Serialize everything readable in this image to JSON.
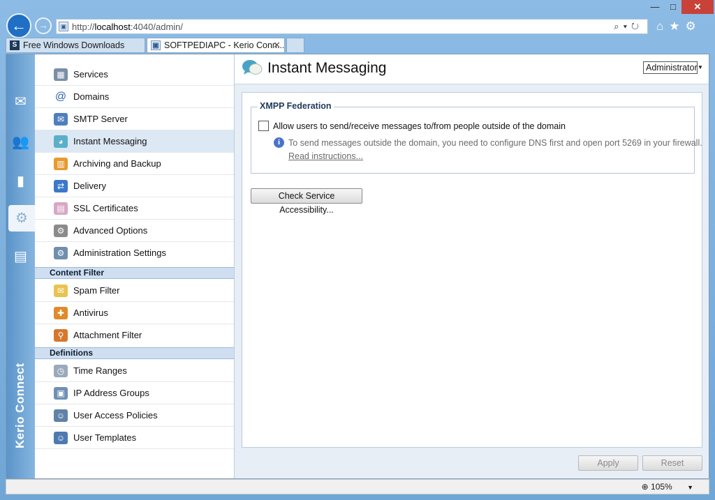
{
  "browser": {
    "url_prefix": "http://",
    "url_host": "localhost",
    "url_rest": ":4040/admin/",
    "tabs": [
      {
        "label": "Free Windows Downloads",
        "icon": "S"
      },
      {
        "label": "SOFTPEDIAPC - Kerio Conn...",
        "close": "✕"
      }
    ],
    "window_controls": {
      "minimize": "—",
      "maximize": "□",
      "close": "✕"
    },
    "zoom": "105%"
  },
  "rail": {
    "brand": "Kerio Connect",
    "icons": [
      "mail-icon",
      "users-icon",
      "statistics-icon",
      "settings-icon",
      "logs-icon"
    ]
  },
  "menu": {
    "items": [
      {
        "label": "Services",
        "icon": "services-icon"
      },
      {
        "label": "Domains",
        "icon": "at-sign-icon"
      },
      {
        "label": "SMTP Server",
        "icon": "smtp-server-icon"
      },
      {
        "label": "Instant Messaging",
        "icon": "chat-bubbles-icon"
      },
      {
        "label": "Archiving and Backup",
        "icon": "archive-icon"
      },
      {
        "label": "Delivery",
        "icon": "delivery-icon"
      },
      {
        "label": "SSL Certificates",
        "icon": "certificate-icon"
      },
      {
        "label": "Advanced Options",
        "icon": "gears-icon"
      },
      {
        "label": "Administration Settings",
        "icon": "admin-settings-icon"
      }
    ],
    "content_filter": {
      "title": "Content Filter",
      "items": [
        {
          "label": "Spam Filter",
          "icon": "spam-icon"
        },
        {
          "label": "Antivirus",
          "icon": "antivirus-icon"
        },
        {
          "label": "Attachment Filter",
          "icon": "attachment-icon"
        }
      ]
    },
    "definitions": {
      "title": "Definitions",
      "items": [
        {
          "label": "Time Ranges",
          "icon": "clock-icon"
        },
        {
          "label": "IP Address Groups",
          "icon": "ip-group-icon"
        },
        {
          "label": "User Access Policies",
          "icon": "access-policy-icon"
        },
        {
          "label": "User Templates",
          "icon": "user-template-icon"
        }
      ]
    }
  },
  "main": {
    "title": "Instant Messaging",
    "user_select": "Administrator",
    "xmpp": {
      "legend": "XMPP Federation",
      "checkbox_label": "Allow users to send/receive messages to/from people outside of the domain",
      "checked": false,
      "info_text": "To send messages outside the domain, you need to configure DNS first and open port 5269 in your firewall.",
      "info_link": "Read instructions..."
    },
    "check_button": "Check Service Accessibility...",
    "apply_button": "Apply",
    "reset_button": "Reset"
  }
}
